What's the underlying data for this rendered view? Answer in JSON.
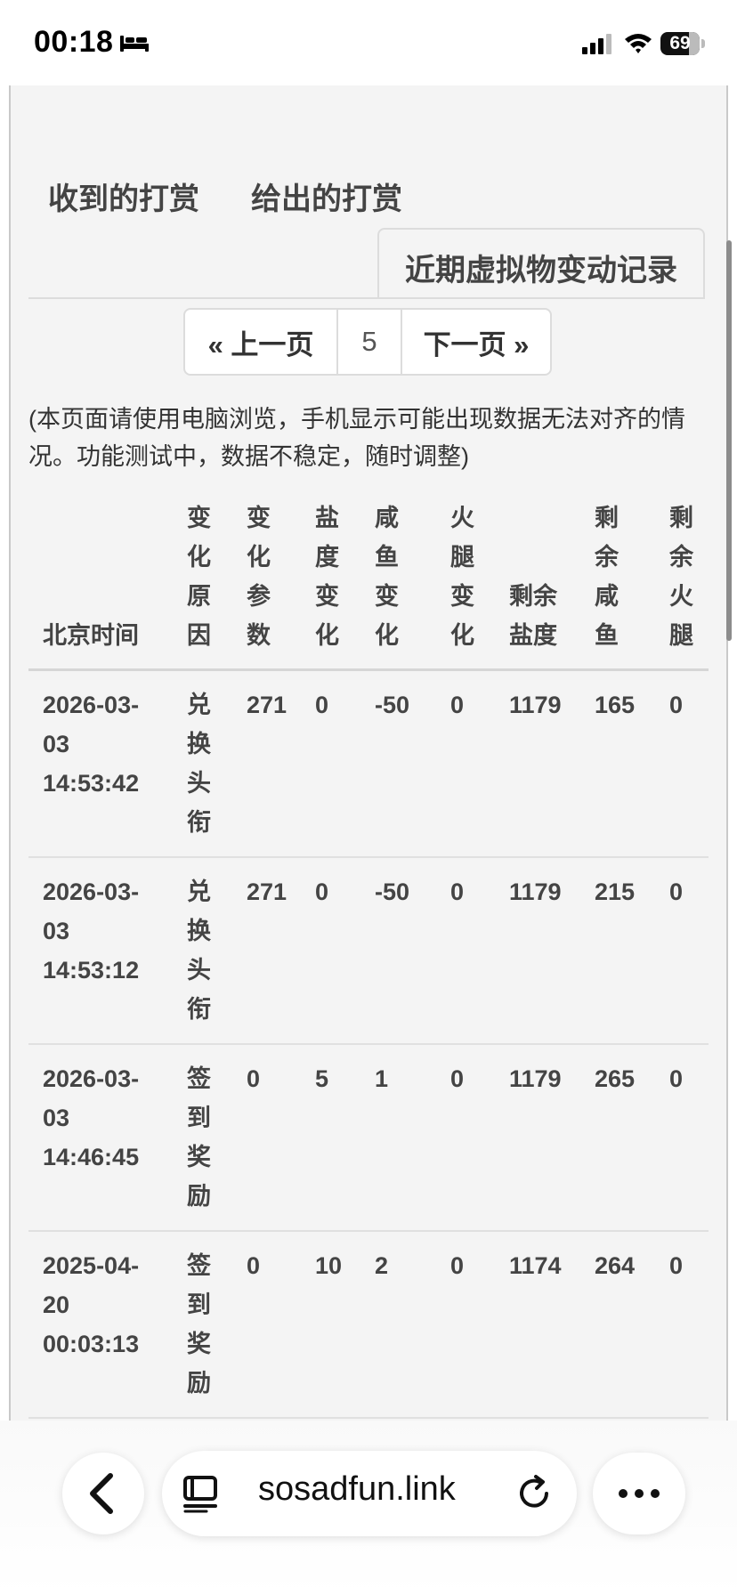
{
  "status_bar": {
    "time": "00:18",
    "sleep_icon": "bed-icon",
    "signal_icon": "signal-icon",
    "wifi_icon": "wifi-icon",
    "battery_level": "69"
  },
  "tabs": {
    "received": "收到的打赏",
    "given": "给出的打赏",
    "active": "近期虚拟物变动记录"
  },
  "pagination": {
    "prev": "« 上一页",
    "current": "5",
    "next": "下一页 »"
  },
  "note": "(本页面请使用电脑浏览，手机显示可能出现数据无法对齐的情况。功能测试中，数据不稳定，随时调整)",
  "table": {
    "headers": [
      "北京时间",
      "变化原因",
      "变化参数",
      "盐度变化",
      "咸鱼变化",
      "火腿变化",
      "剩余盐度",
      "剩余咸鱼",
      "剩余火腿"
    ],
    "rows": [
      {
        "time": "2026-03-03 14:53:42",
        "reason": "兑换头衔",
        "param": "271",
        "salt_change": "0",
        "fish_change": "-50",
        "ham_change": "0",
        "salt_left": "1179",
        "fish_left": "165",
        "ham_left": "0"
      },
      {
        "time": "2026-03-03 14:53:12",
        "reason": "兑换头衔",
        "param": "271",
        "salt_change": "0",
        "fish_change": "-50",
        "ham_change": "0",
        "salt_left": "1179",
        "fish_left": "215",
        "ham_left": "0"
      },
      {
        "time": "2026-03-03 14:46:45",
        "reason": "签到奖励",
        "param": "0",
        "salt_change": "5",
        "fish_change": "1",
        "ham_change": "0",
        "salt_left": "1179",
        "fish_left": "265",
        "ham_left": "0"
      },
      {
        "time": "2025-04-20 00:03:13",
        "reason": "签到奖励",
        "param": "0",
        "salt_change": "10",
        "fish_change": "2",
        "ham_change": "0",
        "salt_left": "1174",
        "fish_left": "264",
        "ham_left": "0"
      }
    ]
  },
  "browser": {
    "back_icon": "chevron-left-icon",
    "reader_icon": "reader-icon",
    "url": "sosadfun.link",
    "reload_icon": "reload-icon",
    "more_icon": "more-icon"
  }
}
